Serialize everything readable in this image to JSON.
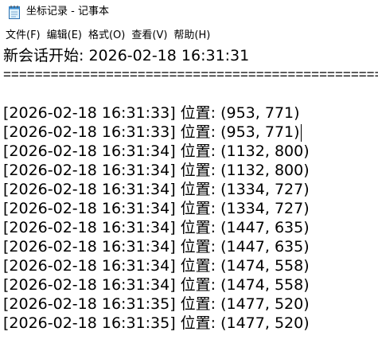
{
  "window": {
    "title": "坐标记录 - 记事本",
    "icon": "notepad-icon"
  },
  "menu": [
    {
      "label": "文件(F)"
    },
    {
      "label": "编辑(E)"
    },
    {
      "label": "格式(O)"
    },
    {
      "label": "查看(V)"
    },
    {
      "label": "帮助(H)"
    }
  ],
  "document": {
    "session_line": "新会话开始: 2026-02-18 16:31:31",
    "separator": "==================================================",
    "records": [
      {
        "text": "[2026-02-18 16:31:33] 位置: (953, 771)"
      },
      {
        "text": "[2026-02-18 16:31:33] 位置: (953, 771)"
      },
      {
        "text": "[2026-02-18 16:31:34] 位置: (1132, 800)"
      },
      {
        "text": "[2026-02-18 16:31:34] 位置: (1132, 800)"
      },
      {
        "text": "[2026-02-18 16:31:34] 位置: (1334, 727)"
      },
      {
        "text": "[2026-02-18 16:31:34] 位置: (1334, 727)"
      },
      {
        "text": "[2026-02-18 16:31:34] 位置: (1447, 635)"
      },
      {
        "text": "[2026-02-18 16:31:34] 位置: (1447, 635)"
      },
      {
        "text": "[2026-02-18 16:31:34] 位置: (1474, 558)"
      },
      {
        "text": "[2026-02-18 16:31:34] 位置: (1474, 558)"
      },
      {
        "text": "[2026-02-18 16:31:35] 位置: (1477, 520)"
      },
      {
        "text": "[2026-02-18 16:31:35] 位置: (1477, 520)"
      }
    ]
  }
}
